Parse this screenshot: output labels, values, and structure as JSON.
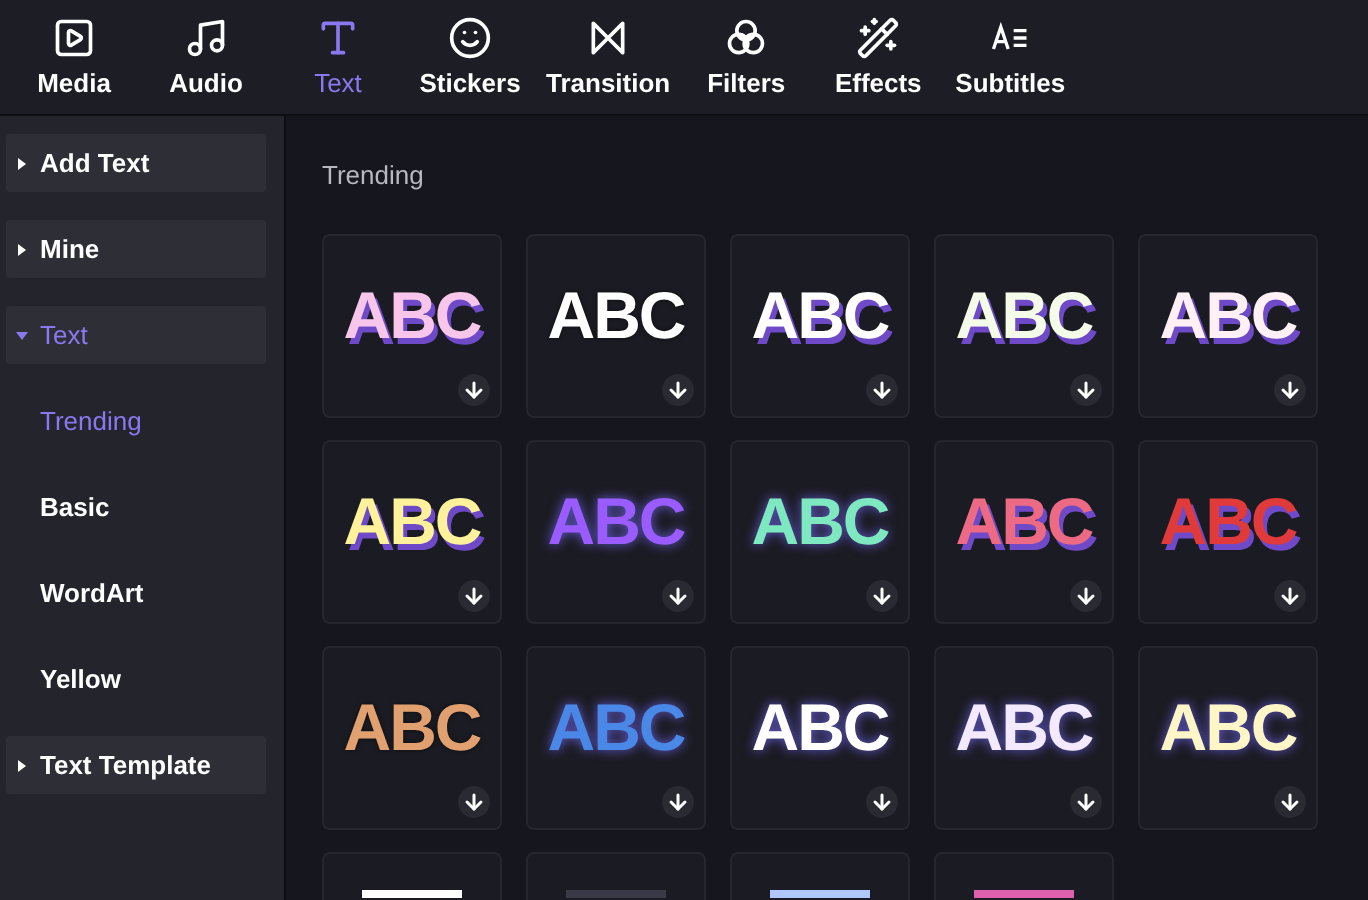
{
  "toolbar": [
    {
      "label": "Media",
      "kind": "media",
      "selected": false
    },
    {
      "label": "Audio",
      "kind": "audio",
      "selected": false
    },
    {
      "label": "Text",
      "kind": "text",
      "selected": true
    },
    {
      "label": "Stickers",
      "kind": "stickers",
      "selected": false
    },
    {
      "label": "Transition",
      "kind": "transition",
      "selected": false
    },
    {
      "label": "Filters",
      "kind": "filters",
      "selected": false
    },
    {
      "label": "Effects",
      "kind": "effects",
      "selected": false
    },
    {
      "label": "Subtitles",
      "kind": "subtitles",
      "selected": false
    }
  ],
  "sidebar": {
    "groups": [
      {
        "label": "Add Text",
        "expanded": false,
        "selected": false
      },
      {
        "label": "Mine",
        "expanded": false,
        "selected": false
      },
      {
        "label": "Text",
        "expanded": true,
        "selected": true,
        "children": [
          {
            "label": "Trending",
            "selected": true
          },
          {
            "label": "Basic",
            "selected": false
          },
          {
            "label": "WordArt",
            "selected": false
          },
          {
            "label": "Yellow",
            "selected": false
          }
        ]
      },
      {
        "label": "Text Template",
        "expanded": false,
        "selected": false
      }
    ]
  },
  "section_title": "Trending",
  "tiles": [
    {
      "text": "ABC",
      "kind": "shadow",
      "color": "#f7c6ea"
    },
    {
      "text": "ABC",
      "kind": "outline",
      "color": "#ffffff"
    },
    {
      "text": "ABC",
      "kind": "shadow",
      "color": "#ffffff"
    },
    {
      "text": "ABC",
      "kind": "shadow",
      "color": "#f4fbe8"
    },
    {
      "text": "ABC",
      "kind": "shadow",
      "color": "#fff0f6"
    },
    {
      "text": "ABC",
      "kind": "shadow",
      "color": "#fff29a"
    },
    {
      "text": "ABC",
      "kind": "glow",
      "color": "#9a5cff"
    },
    {
      "text": "ABC",
      "kind": "glow",
      "color": "#7ee8c0"
    },
    {
      "text": "ABC",
      "kind": "shadow",
      "color": "#ec6a84"
    },
    {
      "text": "ABC",
      "kind": "shadow",
      "color": "#e03a3a"
    },
    {
      "text": "ABC",
      "kind": "outline",
      "color": "#e0a070"
    },
    {
      "text": "ABC",
      "kind": "glow",
      "color": "#4a88e8"
    },
    {
      "text": "ABC",
      "kind": "glow",
      "color": "#ffffff"
    },
    {
      "text": "ABC",
      "kind": "glow",
      "color": "#f4eaff"
    },
    {
      "text": "ABC",
      "kind": "glow",
      "color": "#fff6c8"
    }
  ],
  "partial_tiles": [
    {
      "color": "#ffffff"
    },
    {
      "color": "#3a3a46"
    },
    {
      "color": "#b0c8ff"
    },
    {
      "color": "#e060b0"
    }
  ]
}
